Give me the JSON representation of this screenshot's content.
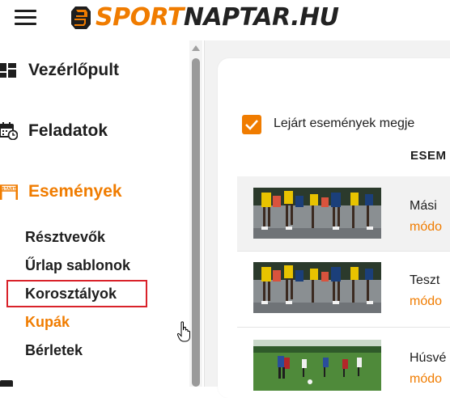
{
  "header": {
    "logo_part1": "SPORT",
    "logo_part2": "NAPTAR.HU",
    "brand_color": "#f07c00"
  },
  "sidebar": {
    "items": [
      {
        "label": "Vezérlőpult",
        "icon": "dashboard-icon",
        "active": false
      },
      {
        "label": "Feladatok",
        "icon": "calendar-clock-icon",
        "active": false
      },
      {
        "label": "Események",
        "icon": "start-gate-icon",
        "active": true
      }
    ],
    "sub_items": [
      {
        "label": "Résztvevők",
        "active": false
      },
      {
        "label": "Űrlap sablonok",
        "active": false
      },
      {
        "label": "Korosztályok",
        "active": false,
        "highlighted": true
      },
      {
        "label": "Kupák",
        "active": true
      },
      {
        "label": "Bérletek",
        "active": false
      }
    ]
  },
  "main": {
    "checkbox_label": "Lejárt események megje",
    "checkbox_checked": true,
    "column_header": "ESEM",
    "events": [
      {
        "title": "Mási",
        "link": "módo",
        "image": "runners-photo"
      },
      {
        "title": "Teszt",
        "link": "módo",
        "image": "runners-photo"
      },
      {
        "title": "Húsvé",
        "link": "módo",
        "image": "kids-football-photo"
      }
    ]
  }
}
